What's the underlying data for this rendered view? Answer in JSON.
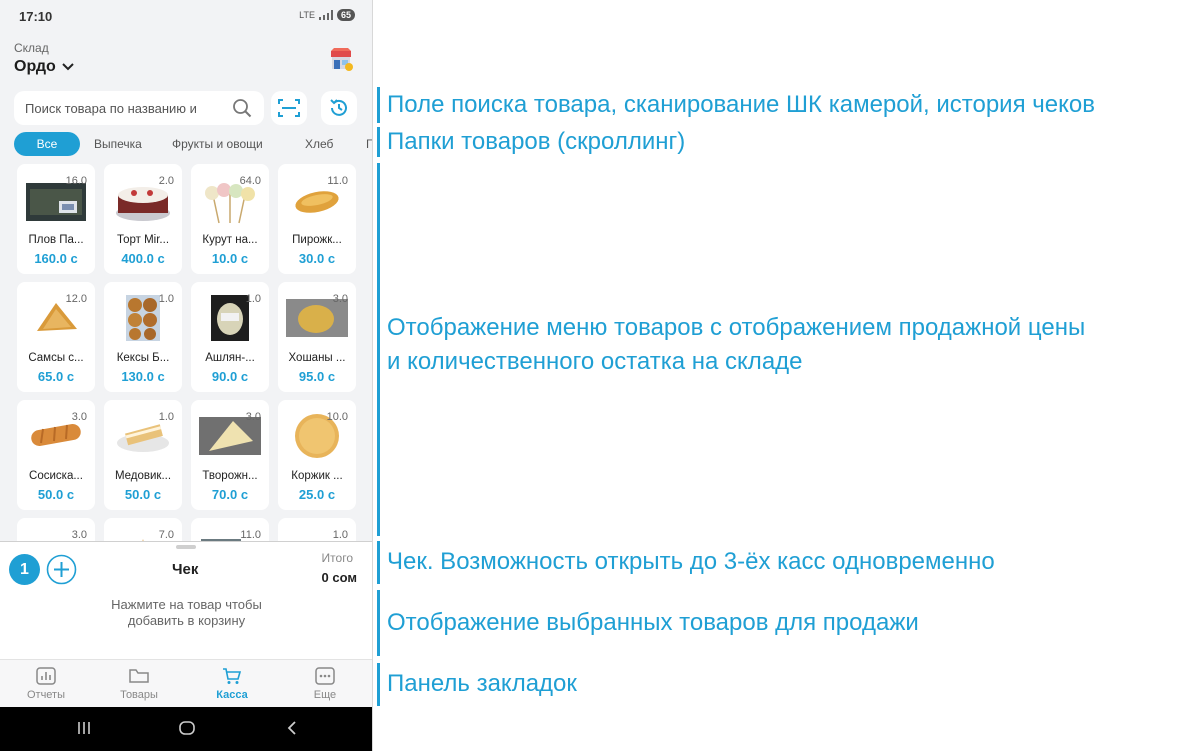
{
  "status_bar": {
    "time": "17:10",
    "network": "LTE",
    "battery": "65"
  },
  "header": {
    "warehouse_label": "Склад",
    "warehouse_value": "Ордо"
  },
  "search": {
    "placeholder": "Поиск товара по названию и"
  },
  "folders": [
    {
      "label": "Все",
      "active": true
    },
    {
      "label": "Выпечка",
      "active": false
    },
    {
      "label": "Фрукты и овощи",
      "active": false
    },
    {
      "label": "Хлеб",
      "active": false
    },
    {
      "label": "Г",
      "active": false
    }
  ],
  "products": [
    {
      "name": "Плов Па...",
      "price": "160.0 с",
      "qty": "16.0",
      "image": "plov-box"
    },
    {
      "name": "Торт Mir...",
      "price": "400.0 с",
      "qty": "2.0",
      "image": "cake"
    },
    {
      "name": "Курут на...",
      "price": "10.0 с",
      "qty": "64.0",
      "image": "kurut-sticks"
    },
    {
      "name": "Пирожк...",
      "price": "30.0 с",
      "qty": "11.0",
      "image": "pie"
    },
    {
      "name": "Самсы с...",
      "price": "65.0 с",
      "qty": "12.0",
      "image": "samsa"
    },
    {
      "name": "Кексы Б...",
      "price": "130.0 с",
      "qty": "1.0",
      "image": "muffins-pack"
    },
    {
      "name": "Ашлян-...",
      "price": "90.0 с",
      "qty": "1.0",
      "image": "ashlyan-box"
    },
    {
      "name": "Хошаны ...",
      "price": "95.0 с",
      "qty": "3.0",
      "image": "hoshan"
    },
    {
      "name": "Сосиска...",
      "price": "50.0 с",
      "qty": "3.0",
      "image": "sausage-roll"
    },
    {
      "name": "Медовик...",
      "price": "50.0 с",
      "qty": "1.0",
      "image": "medovik"
    },
    {
      "name": "Творожн...",
      "price": "70.0 с",
      "qty": "3.0",
      "image": "curd-pastry"
    },
    {
      "name": "Коржик ...",
      "price": "25.0 с",
      "qty": "10.0",
      "image": "korzhik"
    },
    {
      "name": "",
      "price": "",
      "qty": "3.0",
      "image": "partial"
    },
    {
      "name": "",
      "price": "",
      "qty": "7.0",
      "image": "partial"
    },
    {
      "name": "",
      "price": "",
      "qty": "11.0",
      "image": "partial"
    },
    {
      "name": "",
      "price": "",
      "qty": "1.0",
      "image": "partial"
    }
  ],
  "cart": {
    "register_number": "1",
    "title": "Чек",
    "total_label": "Итого",
    "total_value": "0 сом",
    "empty_hint_line1": "Нажмите на товар чтобы",
    "empty_hint_line2": "добавить в корзину"
  },
  "bottom_nav": [
    {
      "label": "Отчеты",
      "icon": "chart-icon",
      "active": false
    },
    {
      "label": "Товары",
      "icon": "folder-icon",
      "active": false
    },
    {
      "label": "Касса",
      "icon": "cart-icon",
      "active": true
    },
    {
      "label": "Еще",
      "icon": "more-icon",
      "active": false
    }
  ],
  "annotations": {
    "search": "Поле поиска товара, сканирование ШК камерой, история чеков",
    "folders": "Папки товаров (скроллинг)",
    "menu_line1": "Отображение меню товаров с отображением продажной цены",
    "menu_line2": "и количественного остатка на складе",
    "receipt": "Чек. Возможность открыть до 3-ёх касс одновременно",
    "selected": "Отображение выбранных товаров для продажи",
    "tabs": "Панель закладок"
  },
  "colors": {
    "accent": "#1f9fd4",
    "background": "#f2f3f5"
  }
}
